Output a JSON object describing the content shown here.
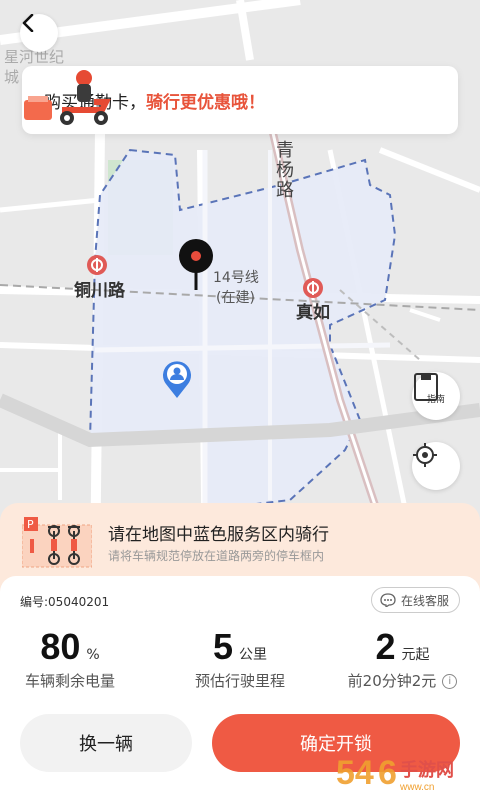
{
  "map": {
    "place_labels": [
      "星河世纪",
      "城"
    ],
    "road_label": "青杨路",
    "stations": [
      {
        "name": "铜川路"
      },
      {
        "name": "真如"
      }
    ],
    "metro_line_label": "14号线",
    "metro_line_status": "(在建)",
    "park_icon_label": "指南"
  },
  "promo": {
    "text_prefix": "购买通勤卡，",
    "text_highlight": "骑行更优惠哦！"
  },
  "notice": {
    "title": "请在地图中蓝色服务区内骑行",
    "subtitle": "请将车辆规范停放在道路两旁的停车框内"
  },
  "sheet": {
    "bike_id": "编号:05040201",
    "service_label": "在线客服",
    "stats": [
      {
        "value": "80",
        "unit": "%",
        "label": "车辆剩余电量"
      },
      {
        "value": "5",
        "unit": "公里",
        "label": "预估行驶里程"
      },
      {
        "value": "2",
        "unit": "元起",
        "label": "前20分钟2元"
      }
    ],
    "swap_label": "换一辆",
    "unlock_label": "确定开锁"
  },
  "colors": {
    "accent": "#ef5a44",
    "service_area_fill": "#e6eaf7",
    "service_area_border": "#5a74b8",
    "notice_bg": "#fde9dc"
  },
  "watermark": "5466手游网"
}
